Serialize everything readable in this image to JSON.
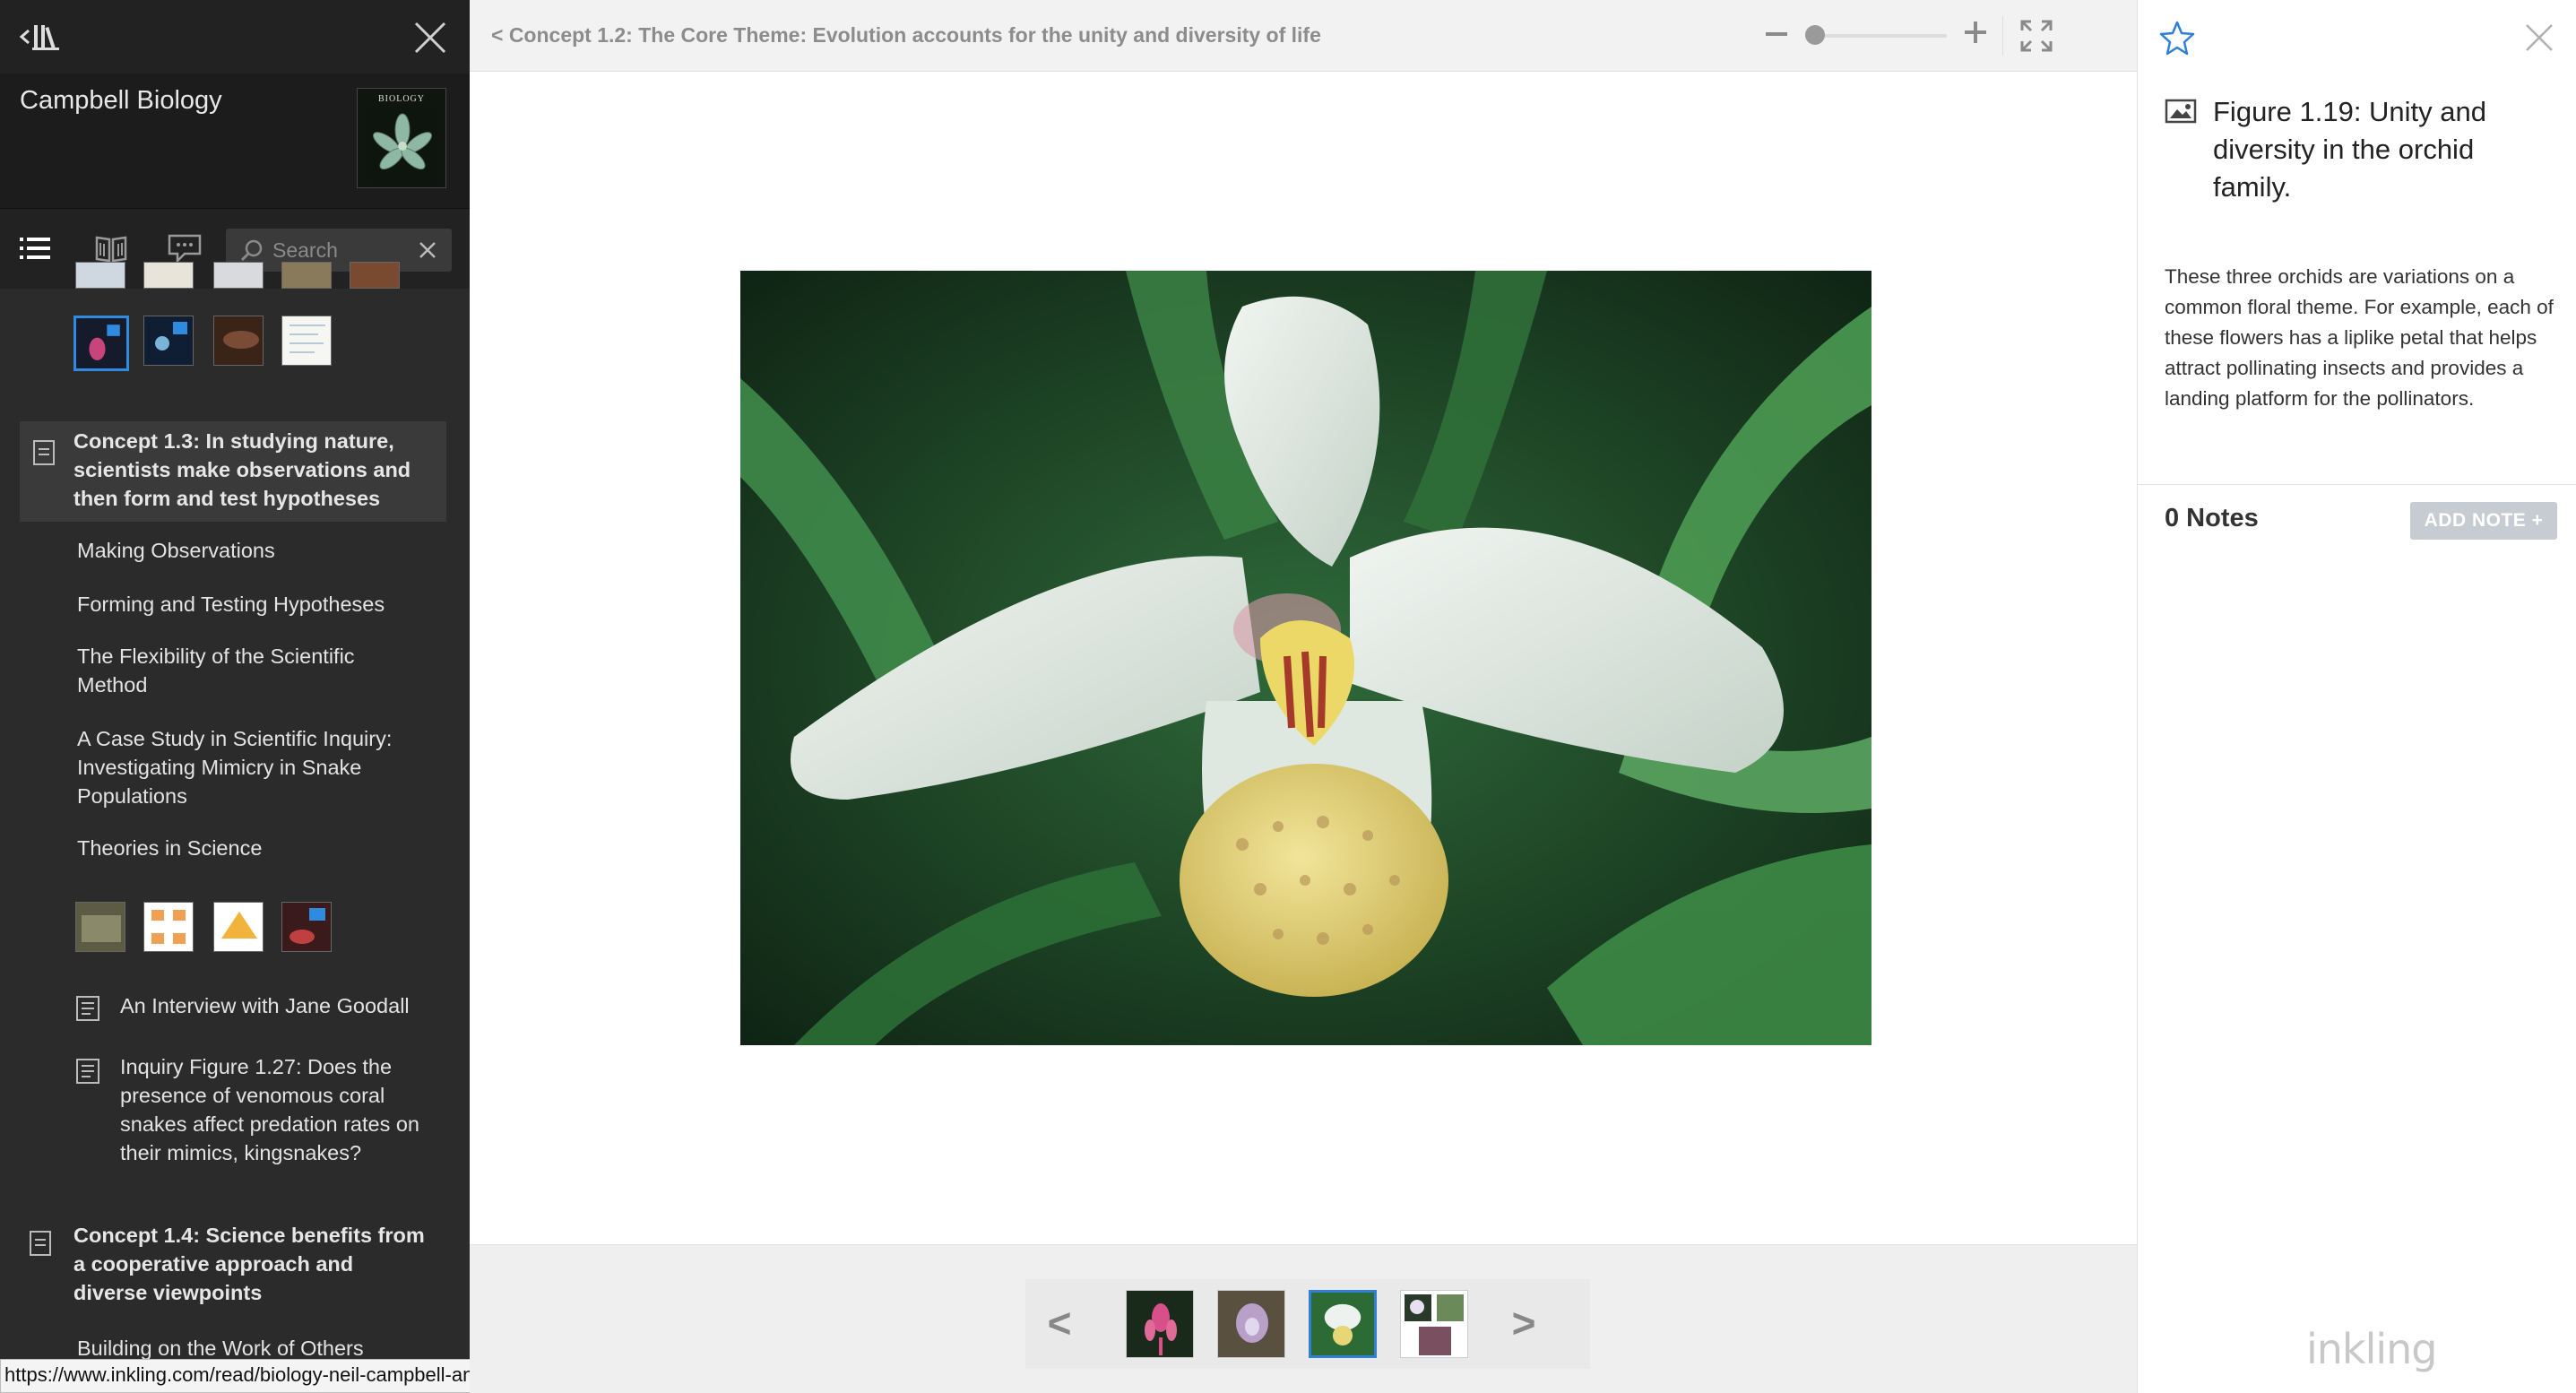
{
  "book": {
    "title": "Campbell Biology",
    "cover_label": "BIOLOGY"
  },
  "search": {
    "placeholder": "Search"
  },
  "toc": {
    "section_13": "Concept 1.3: In studying nature, scientists make observations and then form and test hypotheses",
    "items": [
      "Making Observations",
      "Forming and Testing Hypotheses",
      "The Flexibility of the Scientific Method",
      "A Case Study in Scientific Inquiry: Investigating Mimicry in Snake Populations",
      "Theories in Science"
    ],
    "docs": [
      "An Interview with Jane Goodall",
      "Inquiry Figure 1.27: Does the presence of venomous coral snakes affect predation rates on their mimics, kingsnakes?"
    ],
    "section_14": "Concept 1.4: Science benefits from a cooperative approach and diverse viewpoints",
    "item_last": "Building on the Work of Others"
  },
  "status_url": "https://www.inkling.com/read/biology-neil-campbell-and-jane-reece-9th/chapter-1/concept-1-3-in-studying-n",
  "viewer": {
    "breadcrumb": "< Concept 1.2: The Core Theme: Evolution accounts for the unity and diversity of life",
    "zoom_level": 0.0,
    "nav_prev": "<",
    "nav_next": ">"
  },
  "panel": {
    "figure_title": "Figure 1.19: Unity and diversity in the orchid family.",
    "caption": "These three orchids are variations on a common floral theme. For example, each of these flowers has a liplike petal that helps attract pollinating insects and provides a landing platform for the pollinators.",
    "notes_count": "0 Notes",
    "add_note": "ADD NOTE +",
    "brand": "inkling"
  },
  "colors": {
    "accent": "#2f7fd6",
    "sidebar_bg": "#2b2b2b",
    "section_bg": "#3a3a3a"
  },
  "icons": [
    "library-icon",
    "close-icon",
    "toc-list-icon",
    "book-icon",
    "comment-icon",
    "search-icon",
    "star-icon",
    "image-icon",
    "fullscreen-icon"
  ]
}
